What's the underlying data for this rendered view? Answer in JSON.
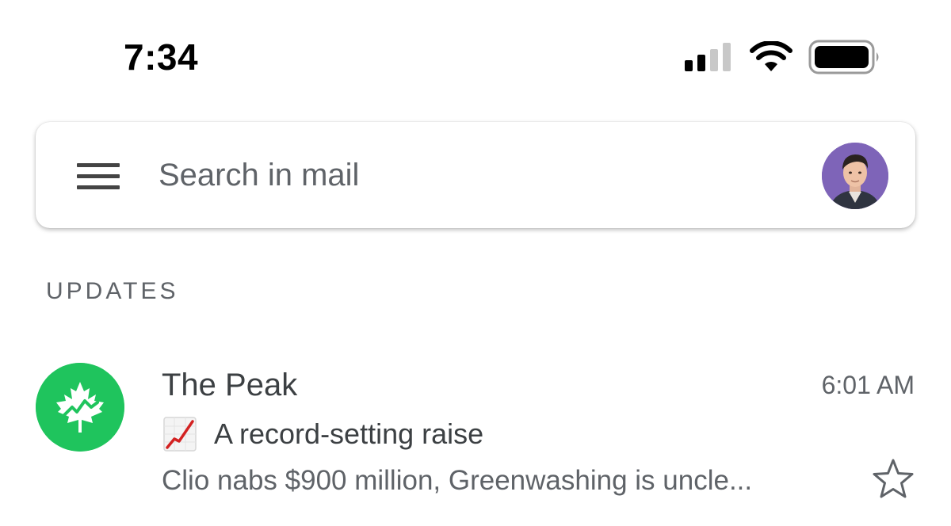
{
  "status_bar": {
    "time": "7:34",
    "signal_icon": "cellular-signal-icon",
    "wifi_icon": "wifi-icon",
    "battery_icon": "battery-icon"
  },
  "search": {
    "placeholder": "Search in mail",
    "menu_icon": "hamburger-menu-icon",
    "account_avatar": "user-avatar"
  },
  "section": {
    "title": "UPDATES"
  },
  "emails": [
    {
      "sender": "The Peak",
      "time": "6:01 AM",
      "subject_icon": "chart-increasing-icon",
      "subject": "A record-setting raise",
      "snippet": "Clio nabs $900 million, Greenwashing is uncle...",
      "avatar_icon": "maple-leaf-icon",
      "avatar_color": "#1fc45d",
      "starred": false
    }
  ],
  "colors": {
    "accent_green": "#1fc45d",
    "avatar_purple": "#7e64b8",
    "text_primary": "#3c4043",
    "text_secondary": "#5f6368"
  }
}
